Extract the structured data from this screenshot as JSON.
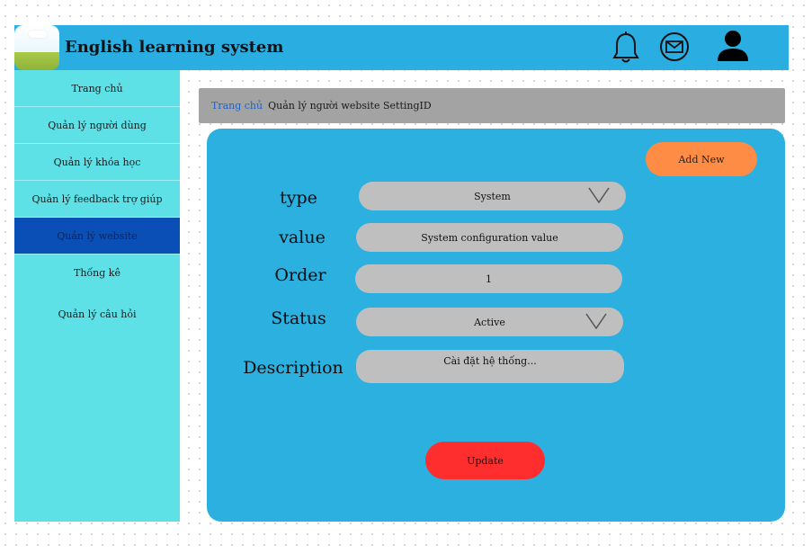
{
  "header": {
    "title": "English learning system",
    "background": "#2aaee2",
    "icons": [
      "bell-icon",
      "mail-icon",
      "user-icon"
    ]
  },
  "sidebar": {
    "background": "#5de0e6",
    "active_color": "#0a4fb5",
    "items": [
      {
        "label": "Trang chủ"
      },
      {
        "label": "Quản lý người dùng"
      },
      {
        "label": "Quản lý khóa học"
      },
      {
        "label": "Quản lý feedback trợ giúp"
      },
      {
        "label": "Quản lý website",
        "active": true
      },
      {
        "label": "Thống kê"
      },
      {
        "label": "Quản lý câu hỏi"
      }
    ]
  },
  "breadcrumb": {
    "home": "Trang chủ",
    "current": "Quản lý người website SettingID"
  },
  "form": {
    "add_button": "Add New",
    "fields": {
      "type": {
        "label": "type",
        "value": "System"
      },
      "value": {
        "label": "value",
        "value": "System configuration value"
      },
      "order": {
        "label": "Order",
        "value": "1"
      },
      "status": {
        "label": "Status",
        "value": "Active"
      },
      "description": {
        "label": "Description",
        "value": "Cài đặt hệ thống..."
      }
    },
    "update_button": "Update",
    "panel_color": "#2bb0e0",
    "add_color": "#ff8c45",
    "update_color": "#ff2e2e"
  }
}
